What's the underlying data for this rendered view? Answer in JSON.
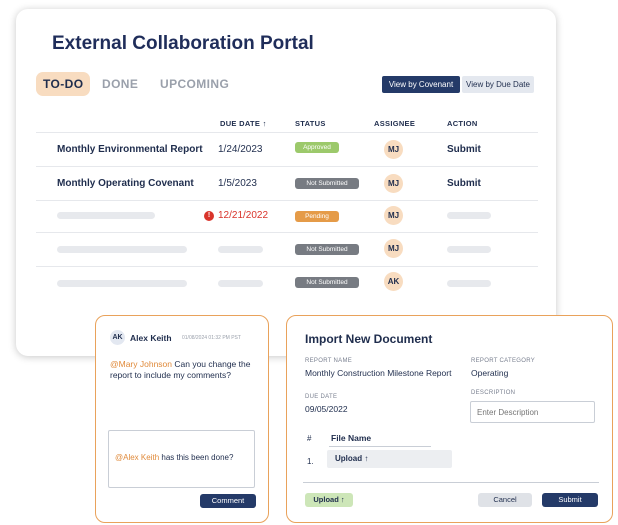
{
  "portal": {
    "title": "External Collaboration Portal",
    "tabs": [
      {
        "label": "TO-DO",
        "active": true
      },
      {
        "label": "DONE",
        "active": false
      },
      {
        "label": "UPCOMING",
        "active": false
      }
    ],
    "view_by_covenant": "View by Covenant",
    "view_by_due_date": "View by Due Date",
    "columns": [
      "DUE DATE",
      "STATUS",
      "ASSIGNEE",
      "ACTION"
    ],
    "sort_arrow": "↑",
    "rows": [
      {
        "name": "Monthly Environmental Report",
        "due": "1/24/2023",
        "status": "Approved",
        "status_color": "#9cc96b",
        "assignee": "MJ",
        "action": "Submit"
      },
      {
        "name": "Monthly Operating Covenant",
        "due": "1/5/2023",
        "status": "Not Submitted",
        "status_color": "#777b82",
        "assignee": "MJ",
        "action": "Submit"
      },
      {
        "name": "",
        "due": "12/21/2022",
        "status": "Pending",
        "status_color": "#e59b48",
        "assignee": "MJ",
        "action": "",
        "overdue": true
      },
      {
        "name": "",
        "due": "",
        "status": "Not Submitted",
        "status_color": "#777b82",
        "assignee": "MJ",
        "action": ""
      },
      {
        "name": "",
        "due": "",
        "status": "Not Submitted",
        "status_color": "#777b82",
        "assignee": "AK",
        "action": ""
      }
    ],
    "alert_glyph": "!"
  },
  "chat": {
    "avatar": "AK",
    "author": "Alex Keith",
    "timestamp": "01/08/2024 01:32 PM PST",
    "mention": "@Mary Johnson",
    "message": " Can you change the report to include my comments?",
    "reply_mention": "@Alex Keith",
    "reply_text": " has this been done?",
    "comment_button": "Comment"
  },
  "import": {
    "title": "Import New Document",
    "report_name_label": "REPORT NAME",
    "report_name": "Monthly Construction Milestone Report",
    "report_category_label": "REPORT CATEGORY",
    "report_category": "Operating",
    "due_date_label": "DUE DATE",
    "due_date": "09/05/2022",
    "description_label": "DESCRIPTION",
    "description_placeholder": "Enter Description",
    "hash_col": "#",
    "file_name_col": "File Name",
    "row_number": "1.",
    "upload_row_label": "Upload ↑",
    "upload_button": "Upload ↑",
    "cancel_button": "Cancel",
    "submit_button": "Submit"
  },
  "colors": {
    "accent": "#e9a25b",
    "navy": "#243a68",
    "danger": "#d9342b"
  }
}
